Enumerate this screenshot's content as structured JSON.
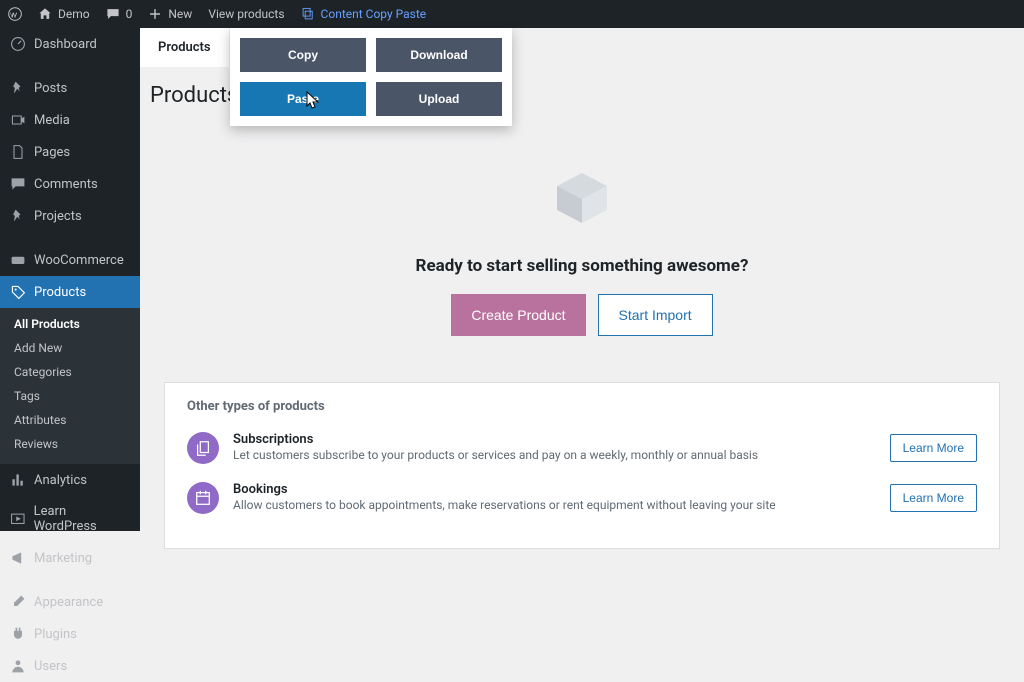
{
  "adminbar": {
    "site": "Demo",
    "comments": "0",
    "new": "New",
    "view_products": "View products",
    "ccp": "Content Copy Paste"
  },
  "sidebar": {
    "items": [
      {
        "label": "Dashboard",
        "active": false
      },
      {
        "label": "Posts",
        "active": false
      },
      {
        "label": "Media",
        "active": false
      },
      {
        "label": "Pages",
        "active": false
      },
      {
        "label": "Comments",
        "active": false
      },
      {
        "label": "Projects",
        "active": false
      },
      {
        "label": "WooCommerce",
        "active": false
      },
      {
        "label": "Products",
        "active": true
      },
      {
        "label": "Analytics",
        "active": false
      },
      {
        "label": "Learn WordPress",
        "active": false
      },
      {
        "label": "Marketing",
        "active": false
      },
      {
        "label": "Appearance",
        "active": false
      },
      {
        "label": "Plugins",
        "active": false
      },
      {
        "label": "Users",
        "active": false
      }
    ],
    "submenu": {
      "items": [
        "All Products",
        "Add New",
        "Categories",
        "Tags",
        "Attributes",
        "Reviews"
      ]
    }
  },
  "main": {
    "tab": "Products",
    "title": "Products",
    "onboard_heading": "Ready to start selling something awesome?",
    "create_btn": "Create Product",
    "import_btn": "Start Import",
    "others_heading": "Other types of products",
    "suggestions": [
      {
        "title": "Subscriptions",
        "desc": "Let customers subscribe to your products or services and pay on a weekly, monthly or annual basis"
      },
      {
        "title": "Bookings",
        "desc": "Allow customers to book appointments, make reservations or rent equipment without leaving your site"
      }
    ],
    "learn_more": "Learn More"
  },
  "ccp": {
    "copy": "Copy",
    "download": "Download",
    "paste": "Paste",
    "upload": "Upload"
  },
  "colors": {
    "accent": "#2271b1",
    "wc_pink": "#b9729e",
    "wc_purple": "#8f6ac7"
  }
}
